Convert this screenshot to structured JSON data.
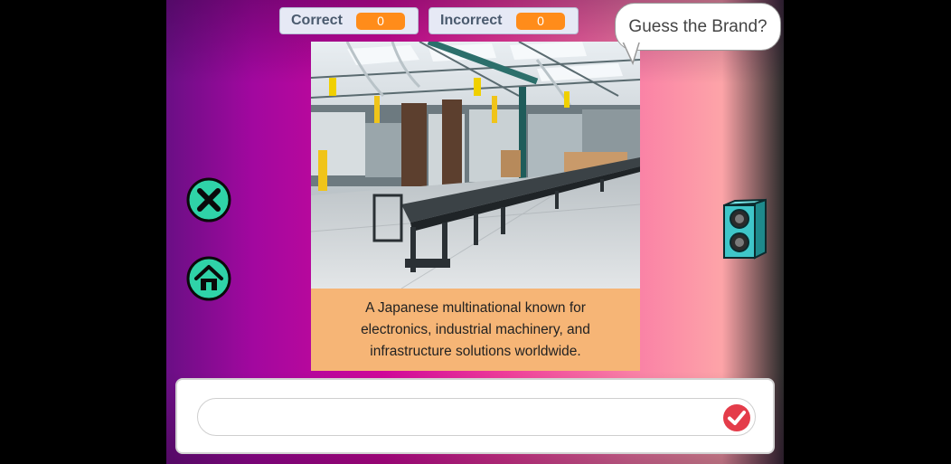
{
  "game": {
    "correct_label": "Correct",
    "correct_value": "0",
    "incorrect_label": "Incorrect",
    "incorrect_value": "0",
    "prompt": "Guess the Brand?"
  },
  "clue": {
    "text": "A Japanese multinational known for electronics, industrial machinery, and infrastructure solutions worldwide."
  },
  "answer": {
    "value": "",
    "placeholder": ""
  },
  "icons": {
    "close": "close-icon",
    "home": "home-icon",
    "speaker": "speaker-icon",
    "submit": "checkmark-icon"
  },
  "colors": {
    "score_badge": "#ff8c1a",
    "button_fill": "#2fd3a8",
    "caption_bg": "#f6b576",
    "speaker_fill": "#3fc6c9",
    "submit_fill": "#e43c4a"
  }
}
